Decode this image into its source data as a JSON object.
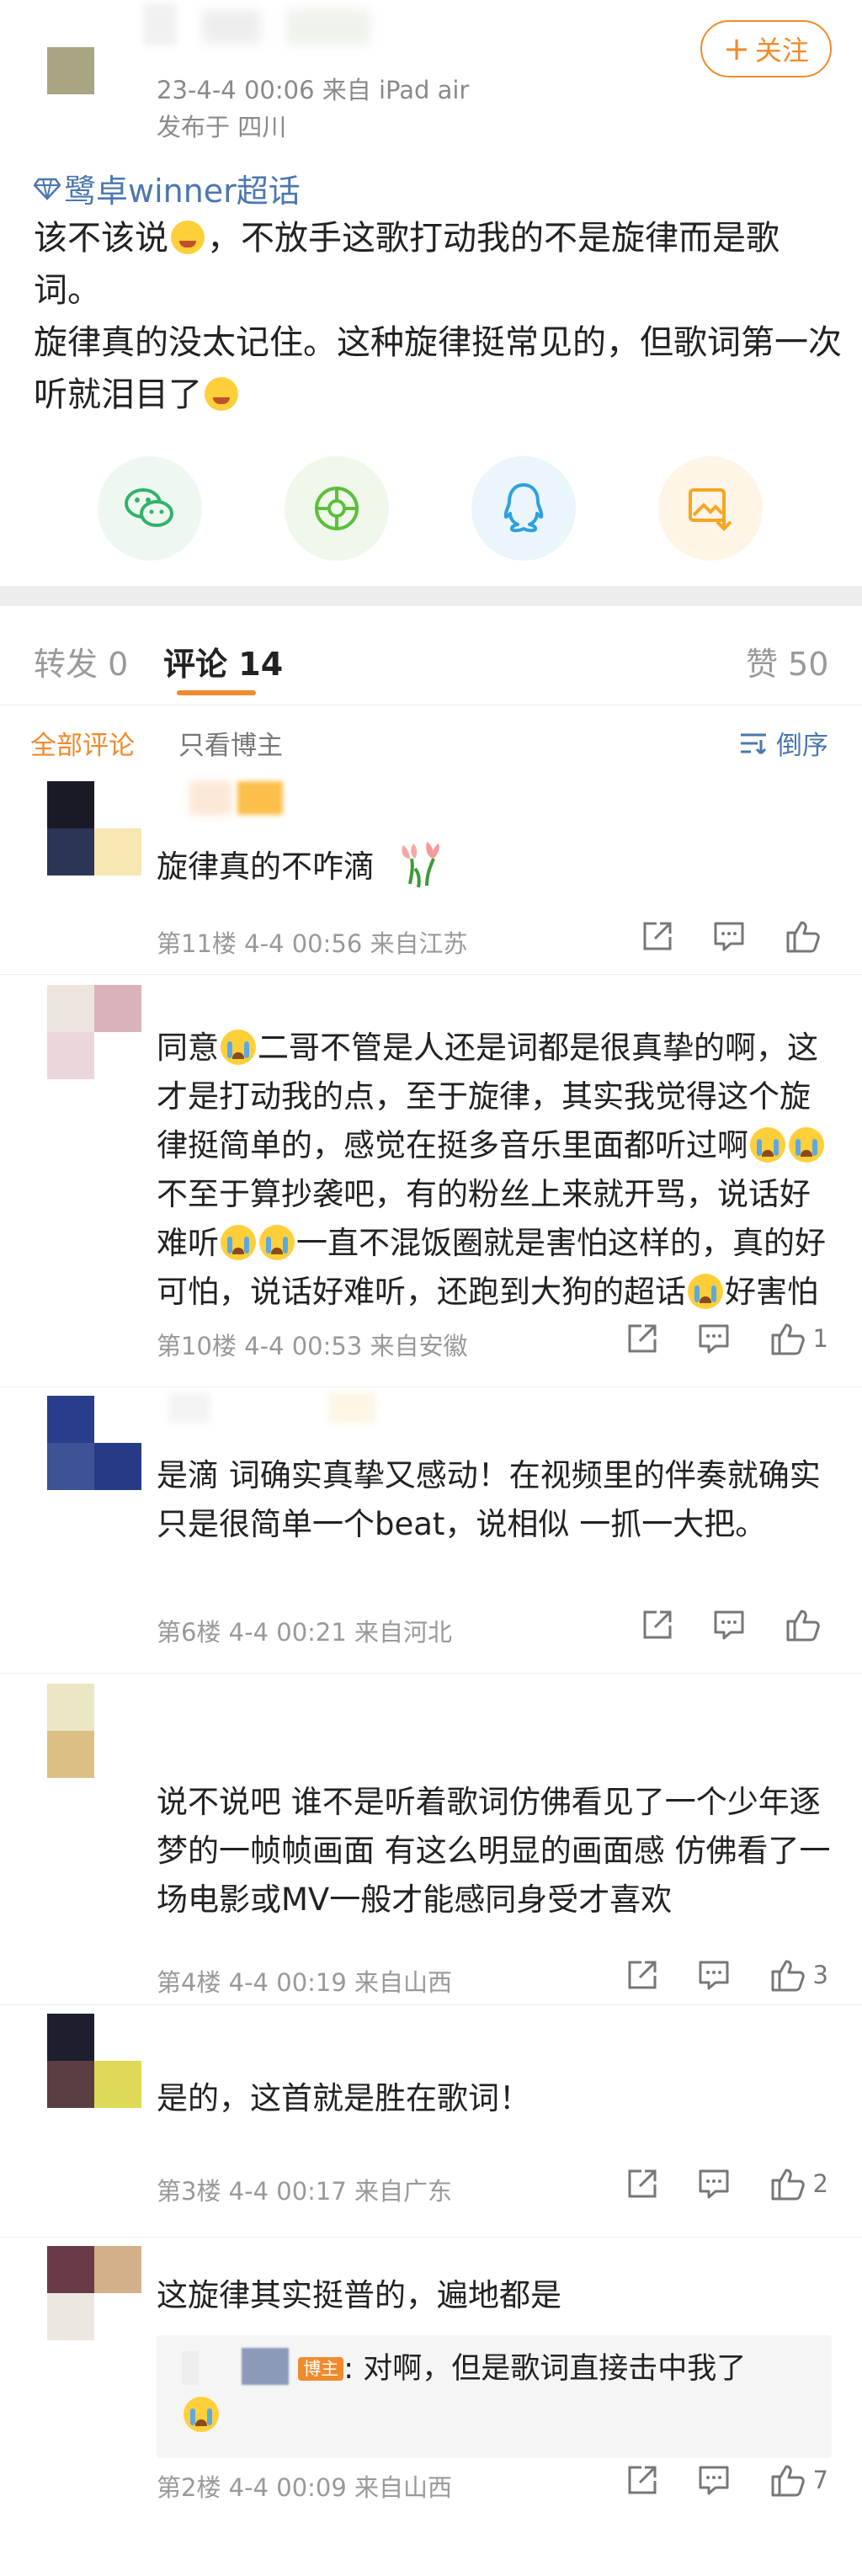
{
  "post": {
    "time_source": "23-4-4 00:06  来自 iPad air",
    "location": "发布于 四川",
    "follow_label": "关注",
    "topic": "鹭卓winner超话",
    "text_parts": [
      "该不该说",
      "，不放手这歌打动我的不是旋律而是歌词。",
      "旋律真的没太记住。这种旋律挺常见的，但歌词第一次听就泪目了"
    ],
    "share_icons": [
      "wechat-icon",
      "moments-icon",
      "qq-icon",
      "save-image-icon"
    ]
  },
  "tabs": {
    "repost_label": "转发",
    "repost_count": "0",
    "comment_label": "评论",
    "comment_count": "14",
    "like_label": "赞",
    "like_count": "50"
  },
  "filters": {
    "all": "全部评论",
    "blogger": "只看博主",
    "sort": "倒序"
  },
  "comments": [
    {
      "id": "c1",
      "parts": [
        "旋律真的不咋滴"
      ],
      "meta": "第11楼 4-4 00:56 来自江苏",
      "likes": ""
    },
    {
      "id": "c2",
      "parts": [
        "同意",
        "二哥不管是人还是词都是很真挚的啊，这才是打动我的点，至于旋律，其实我觉得这个旋律挺简单的，感觉在挺多音乐里面都听过啊",
        "",
        "不至于算抄袭吧，有的粉丝上来就开骂，说话好难听",
        "",
        "一直不混饭圈就是害怕这样的，真的好可怕，说话好难听，还跑到大狗的超话",
        "好害怕"
      ],
      "meta": "第10楼 4-4 00:53 来自安徽",
      "likes": "1"
    },
    {
      "id": "c3",
      "parts": [
        "是滴 词确实真挚又感动！在视频里的伴奏就确实只是很简单一个beat，说相似 一抓一大把。"
      ],
      "meta": "第6楼 4-4 00:21 来自河北",
      "likes": ""
    },
    {
      "id": "c4",
      "parts": [
        "说不说吧 谁不是听着歌词仿佛看见了一个少年逐梦的一帧帧画面 有这么明显的画面感 仿佛看了一场电影或MV一般才能感同身受才喜欢"
      ],
      "meta": "第4楼 4-4 00:19 来自山西",
      "likes": "3"
    },
    {
      "id": "c5",
      "parts": [
        "是的，这首就是胜在歌词！"
      ],
      "meta": "第3楼 4-4 00:17 来自广东",
      "likes": "2"
    },
    {
      "id": "c6",
      "parts": [
        "这旋律其实挺普的，遍地都是"
      ],
      "reply_badge": "博主",
      "reply_text": ": 对啊，但是歌词直接击中我了",
      "meta": "第2楼 4-4 00:09 来自山西",
      "likes": "7"
    }
  ],
  "colors": {
    "accent": "#f08a2c",
    "link": "#4b77b0",
    "meta": "#999999"
  }
}
